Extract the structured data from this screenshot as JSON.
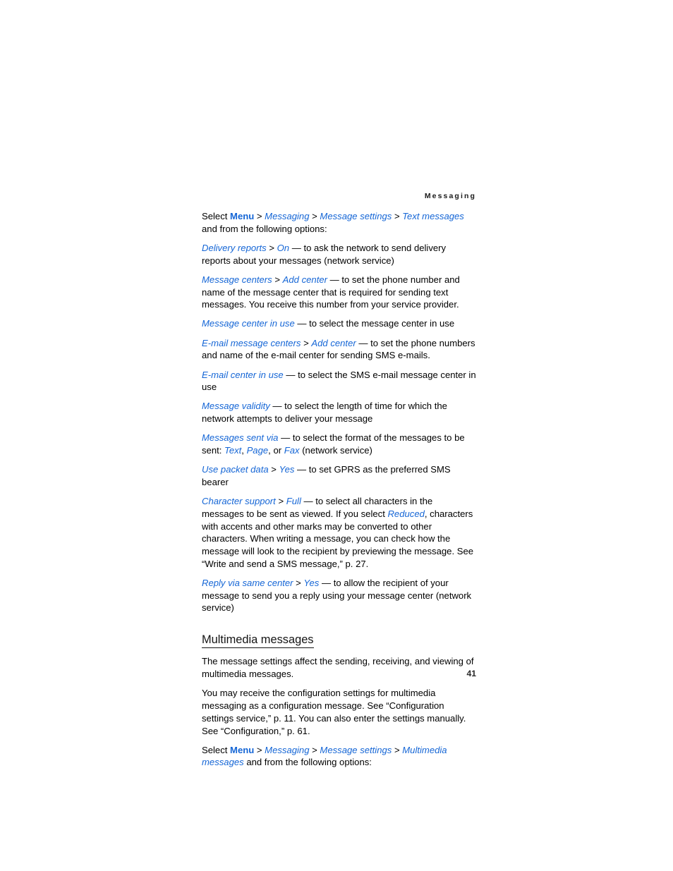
{
  "document": {
    "running_header": "Messaging",
    "page_number": "41"
  },
  "body": {
    "p1": {
      "a": "Select ",
      "menu": "Menu",
      "s1": " > ",
      "t1": "Messaging",
      "s2": " > ",
      "t2": "Message settings",
      "s3": " > ",
      "t3": "Text messages",
      "b": " and from the following options:"
    },
    "p2": {
      "t1": "Delivery reports",
      "s1": " > ",
      "t2": "On",
      "dash": " — ",
      "text": "to ask the network to send delivery reports about your messages (network service)"
    },
    "p3": {
      "t1": "Message centers",
      "s1": " > ",
      "t2": "Add center",
      "dash": " — ",
      "text": "to set the phone number and name of the message center that is required for sending text messages. You receive this number from your service provider."
    },
    "p4": {
      "t1": "Message center in use",
      "dash": " — ",
      "text": "to select the message center in use"
    },
    "p5": {
      "t1": "E-mail message centers",
      "s1": " > ",
      "t2": "Add center",
      "dash": " — ",
      "text": "to set the phone numbers and name of the e-mail center for sending SMS e-mails."
    },
    "p6": {
      "t1": "E-mail center in use",
      "dash": " — ",
      "text": "to select the SMS e-mail message center in use"
    },
    "p7": {
      "t1": "Message validity",
      "dash": " — ",
      "text": "to select the length of time for which the network attempts to deliver your message"
    },
    "p8": {
      "t1": "Messages sent via",
      "dash": " — ",
      "text": "to select the format of the messages to be sent: ",
      "t2": "Text",
      "c1": ", ",
      "t3": "Page",
      "c2": ", or ",
      "t4": "Fax",
      "tail": " (network service)"
    },
    "p9": {
      "t1": "Use packet data",
      "s1": " > ",
      "t2": "Yes",
      "dash": " — ",
      "text": "to set GPRS as the preferred SMS bearer"
    },
    "p10": {
      "t1": "Character support",
      "s1": " > ",
      "t2": "Full",
      "dash": " — ",
      "text_a": "to select all characters in the messages to be sent as viewed. If you select ",
      "t3": "Reduced",
      "text_b": ", characters with accents and other marks may be converted to other characters. When writing a message, you can check how the message will look to the recipient by previewing the message. See “Write and send a SMS message,” p. 27."
    },
    "p11": {
      "t1": "Reply via same center",
      "s1": " > ",
      "t2": "Yes",
      "dash": " — ",
      "text": "to allow the recipient of your message to send you a reply using your message center (network service)"
    },
    "heading_multimedia": "Multimedia messages",
    "p12": {
      "text": "The message settings affect the sending, receiving, and viewing of multimedia messages."
    },
    "p13": {
      "text": "You may receive the configuration settings for multimedia messaging as a configuration message. See “Configuration settings service,” p. 11. You can also enter the settings manually. See “Configuration,” p. 61."
    },
    "p14": {
      "a": "Select ",
      "menu": "Menu",
      "s1": " > ",
      "t1": "Messaging",
      "s2": " > ",
      "t2": "Message settings",
      "s3": " > ",
      "t3": "Multimedia messages",
      "b": " and from the following options:"
    }
  },
  "colors": {
    "link_blue": "#1566d6",
    "body_black": "#000000",
    "heading": "#141414"
  }
}
